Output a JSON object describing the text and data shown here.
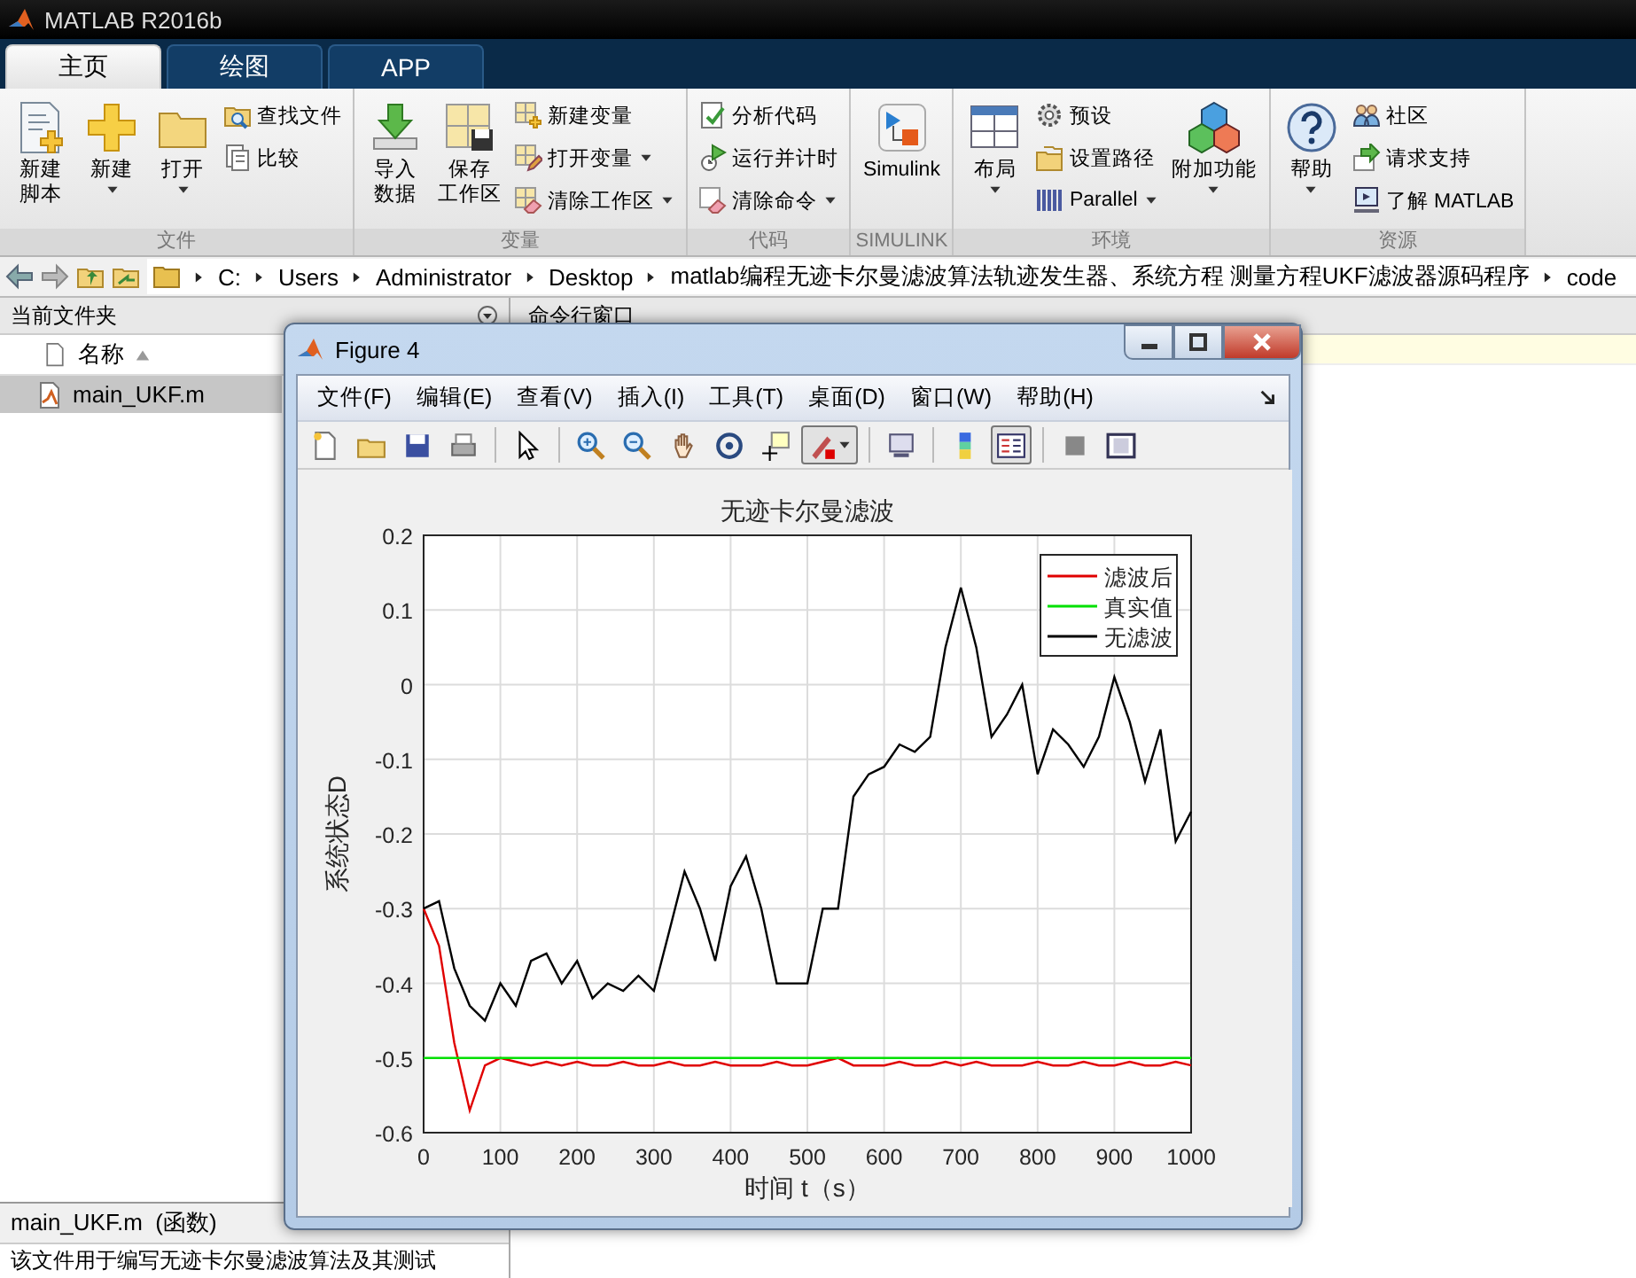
{
  "app": {
    "title": "MATLAB R2016b"
  },
  "tabs": [
    {
      "label": "主页",
      "selected": true
    },
    {
      "label": "绘图",
      "selected": false
    },
    {
      "label": "APP",
      "selected": false
    }
  ],
  "ribbon": [
    {
      "name": "文件",
      "items": [
        {
          "kind": "large",
          "lines": [
            "新建",
            "脚本"
          ],
          "dropdown": false
        },
        {
          "kind": "large",
          "lines": [
            "新建"
          ],
          "dropdown": true
        },
        {
          "kind": "large",
          "lines": [
            "打开"
          ],
          "dropdown": true
        },
        {
          "kind": "small",
          "label": "查找文件",
          "dropdown": false
        },
        {
          "kind": "small",
          "label": "比较",
          "dropdown": false
        }
      ]
    },
    {
      "name": "变量",
      "items": [
        {
          "kind": "large",
          "lines": [
            "导入",
            "数据"
          ],
          "dropdown": false
        },
        {
          "kind": "large",
          "lines": [
            "保存",
            "工作区"
          ],
          "dropdown": false
        },
        {
          "kind": "small",
          "label": "新建变量",
          "dropdown": false
        },
        {
          "kind": "small",
          "label": "打开变量",
          "dropdown": true
        },
        {
          "kind": "small",
          "label": "清除工作区",
          "dropdown": true
        }
      ]
    },
    {
      "name": "代码",
      "items": [
        {
          "kind": "small",
          "label": "分析代码",
          "dropdown": false
        },
        {
          "kind": "small",
          "label": "运行并计时",
          "dropdown": false
        },
        {
          "kind": "small",
          "label": "清除命令",
          "dropdown": true
        }
      ]
    },
    {
      "name": "SIMULINK",
      "items": [
        {
          "kind": "large",
          "lines": [
            "Simulink"
          ],
          "dropdown": false
        }
      ]
    },
    {
      "name": "环境",
      "items": [
        {
          "kind": "large",
          "lines": [
            "布局"
          ],
          "dropdown": true
        },
        {
          "kind": "small",
          "label": "预设",
          "dropdown": false
        },
        {
          "kind": "small",
          "label": "设置路径",
          "dropdown": false
        },
        {
          "kind": "small",
          "label": "Parallel",
          "dropdown": true
        },
        {
          "kind": "large",
          "lines": [
            "附加功能"
          ],
          "dropdown": true
        }
      ]
    },
    {
      "name": "资源",
      "items": [
        {
          "kind": "large",
          "lines": [
            "帮助"
          ],
          "dropdown": true
        },
        {
          "kind": "small",
          "label": "社区",
          "dropdown": false
        },
        {
          "kind": "small",
          "label": "请求支持",
          "dropdown": false
        },
        {
          "kind": "small",
          "label": "了解 MATLAB",
          "dropdown": false
        }
      ]
    }
  ],
  "address": {
    "segments": [
      "C:",
      "Users",
      "Administrator",
      "Desktop",
      "matlab编程无迹卡尔曼滤波算法轨迹发生器、系统方程 测量方程UKF滤波器源码程序",
      "code"
    ]
  },
  "file_panel": {
    "title": "当前文件夹",
    "column": "名称",
    "files": [
      {
        "name": "main_UKF.m",
        "selected": true
      }
    ],
    "details_title": "main_UKF.m  (函数)",
    "description": "该文件用于编写无迹卡尔曼滤波算法及其测试"
  },
  "command_panel": {
    "title": "命令行窗口"
  },
  "figure": {
    "title": "Figure 4",
    "menu": [
      "文件(F)",
      "编辑(E)",
      "查看(V)",
      "插入(I)",
      "工具(T)",
      "桌面(D)",
      "窗口(W)",
      "帮助(H)"
    ],
    "toolbar_buttons": [
      {
        "pressed": false
      },
      {
        "pressed": false
      },
      {
        "pressed": false
      },
      {
        "pressed": false
      },
      {
        "pressed": false
      },
      {
        "pressed": false
      },
      {
        "pressed": false
      },
      {
        "pressed": false
      },
      {
        "pressed": false
      },
      {
        "pressed": false
      },
      {
        "pressed": true
      },
      {
        "pressed": false
      },
      {
        "pressed": false
      },
      {
        "pressed": true
      },
      {
        "pressed": false
      },
      {
        "pressed": false
      }
    ],
    "chart_data": {
      "type": "line",
      "title": "无迹卡尔曼滤波",
      "xlabel": "时间 t（s）",
      "ylabel": "系统状态D",
      "x": [
        0,
        20,
        40,
        60,
        80,
        100,
        120,
        140,
        160,
        180,
        200,
        220,
        240,
        260,
        280,
        300,
        320,
        340,
        360,
        380,
        400,
        420,
        440,
        460,
        480,
        500,
        520,
        540,
        560,
        580,
        600,
        620,
        640,
        660,
        680,
        700,
        720,
        740,
        760,
        780,
        800,
        820,
        840,
        860,
        880,
        900,
        920,
        940,
        960,
        980,
        1000
      ],
      "series": [
        {
          "name": "滤波后",
          "color": "#e00000",
          "values": [
            -0.3,
            -0.35,
            -0.48,
            -0.57,
            -0.51,
            -0.5,
            -0.505,
            -0.51,
            -0.505,
            -0.51,
            -0.505,
            -0.51,
            -0.51,
            -0.505,
            -0.51,
            -0.51,
            -0.505,
            -0.51,
            -0.51,
            -0.505,
            -0.51,
            -0.51,
            -0.51,
            -0.505,
            -0.51,
            -0.51,
            -0.505,
            -0.5,
            -0.51,
            -0.51,
            -0.51,
            -0.505,
            -0.51,
            -0.51,
            -0.505,
            -0.51,
            -0.505,
            -0.51,
            -0.51,
            -0.51,
            -0.505,
            -0.51,
            -0.51,
            -0.505,
            -0.51,
            -0.51,
            -0.505,
            -0.51,
            -0.51,
            -0.505,
            -0.51
          ]
        },
        {
          "name": "真实值",
          "color": "#00e000",
          "values": [
            -0.5,
            -0.5,
            -0.5,
            -0.5,
            -0.5,
            -0.5,
            -0.5,
            -0.5,
            -0.5,
            -0.5,
            -0.5,
            -0.5,
            -0.5,
            -0.5,
            -0.5,
            -0.5,
            -0.5,
            -0.5,
            -0.5,
            -0.5,
            -0.5,
            -0.5,
            -0.5,
            -0.5,
            -0.5,
            -0.5,
            -0.5,
            -0.5,
            -0.5,
            -0.5,
            -0.5,
            -0.5,
            -0.5,
            -0.5,
            -0.5,
            -0.5,
            -0.5,
            -0.5,
            -0.5,
            -0.5,
            -0.5,
            -0.5,
            -0.5,
            -0.5,
            -0.5,
            -0.5,
            -0.5,
            -0.5,
            -0.5,
            -0.5,
            -0.5
          ]
        },
        {
          "name": "无滤波",
          "color": "#000000",
          "values": [
            -0.3,
            -0.29,
            -0.38,
            -0.43,
            -0.45,
            -0.4,
            -0.43,
            -0.37,
            -0.36,
            -0.4,
            -0.37,
            -0.42,
            -0.4,
            -0.41,
            -0.39,
            -0.41,
            -0.33,
            -0.25,
            -0.3,
            -0.37,
            -0.27,
            -0.23,
            -0.3,
            -0.4,
            -0.4,
            -0.4,
            -0.3,
            -0.3,
            -0.15,
            -0.12,
            -0.11,
            -0.08,
            -0.09,
            -0.07,
            0.05,
            0.13,
            0.05,
            -0.07,
            -0.04,
            0.0,
            -0.12,
            -0.06,
            -0.08,
            -0.11,
            -0.07,
            0.01,
            -0.05,
            -0.13,
            -0.06,
            -0.21,
            -0.17
          ]
        }
      ],
      "grid": true,
      "legend": true,
      "xlim": [
        0,
        1000
      ],
      "ylim": [
        -0.6,
        0.2
      ],
      "xticks": [
        0,
        100,
        200,
        300,
        400,
        500,
        600,
        700,
        800,
        900,
        1000
      ],
      "yticks": [
        -0.6,
        -0.5,
        -0.4,
        -0.3,
        -0.2,
        -0.1,
        0,
        0.1,
        0.2
      ]
    }
  }
}
